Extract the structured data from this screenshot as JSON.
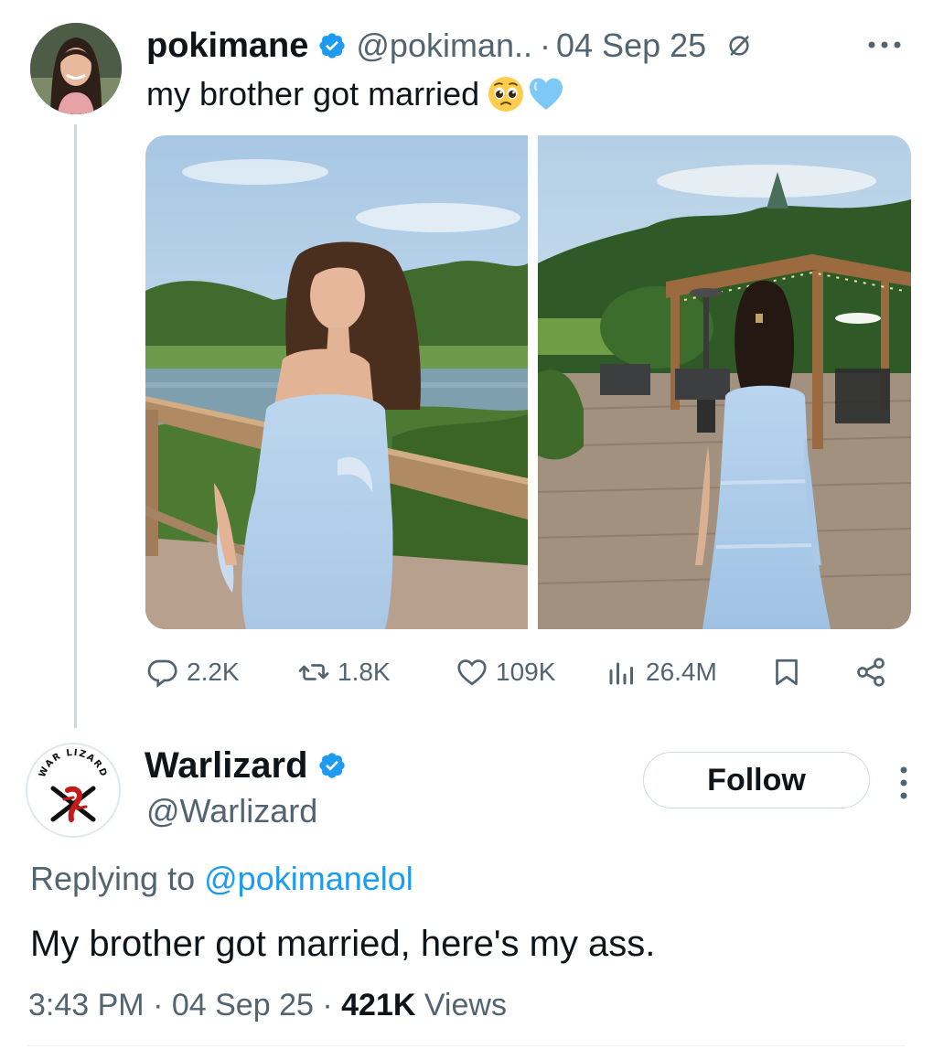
{
  "tweet": {
    "author_name": "pokimane",
    "handle": "@pokiman..",
    "separator": "·",
    "date": "04 Sep 25",
    "text": "my brother got married",
    "emojis": [
      "pleading-face",
      "light-blue-heart"
    ],
    "images": [
      {
        "subject": "woman in light blue dress by lake railing"
      },
      {
        "subject": "woman in light blue dress on patio near pergola"
      }
    ],
    "actions": {
      "replies": "2.2K",
      "reposts": "1.8K",
      "likes": "109K",
      "views": "26.4M"
    }
  },
  "reply": {
    "author_name": "Warlizard",
    "handle": "@Warlizard",
    "avatar_text": "WAR LIZARD",
    "follow_label": "Follow",
    "replying_prefix": "Replying to",
    "replying_handle": "@pokimanelol",
    "text": "My brother got married, here's my ass.",
    "time": "3:43 PM",
    "date": "04 Sep 25",
    "views_count": "421K",
    "views_label": "Views",
    "separator": "·"
  },
  "colors": {
    "verified_blue": "#1d9bf0",
    "muted_text": "#536471",
    "primary_text": "#0f1419"
  },
  "icons": [
    "verified-badge-icon",
    "grok-icon",
    "more-horizontal-icon",
    "reply-icon",
    "repost-icon",
    "like-icon",
    "views-icon",
    "bookmark-icon",
    "share-icon",
    "more-vertical-icon"
  ]
}
